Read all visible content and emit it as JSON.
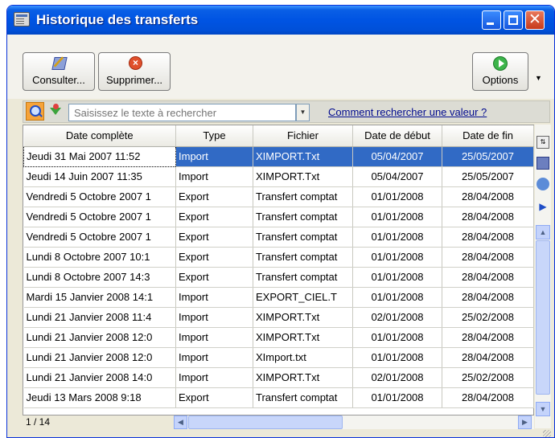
{
  "window": {
    "title": "Historique des transferts"
  },
  "toolbar": {
    "consulter_label": "Consulter...",
    "supprimer_label": "Supprimer...",
    "options_label": "Options"
  },
  "search": {
    "placeholder": "Saisissez le texte à rechercher",
    "help_link": "Comment rechercher une valeur ?"
  },
  "table": {
    "columns": [
      "Date complète",
      "Type",
      "Fichier",
      "Date de début",
      "Date de fin"
    ],
    "rows": [
      [
        "Jeudi 31 Mai 2007 11:52",
        "Import",
        "XIMPORT.Txt",
        "05/04/2007",
        "25/05/2007"
      ],
      [
        "Jeudi 14 Juin 2007 11:35",
        "Import",
        "XIMPORT.Txt",
        "05/04/2007",
        "25/05/2007"
      ],
      [
        "Vendredi 5 Octobre 2007 1",
        "Export",
        "Transfert comptat",
        "01/01/2008",
        "28/04/2008"
      ],
      [
        "Vendredi 5 Octobre 2007 1",
        "Export",
        "Transfert comptat",
        "01/01/2008",
        "28/04/2008"
      ],
      [
        "Vendredi 5 Octobre 2007 1",
        "Export",
        "Transfert comptat",
        "01/01/2008",
        "28/04/2008"
      ],
      [
        "Lundi 8 Octobre 2007 10:1",
        "Export",
        "Transfert comptat",
        "01/01/2008",
        "28/04/2008"
      ],
      [
        "Lundi 8 Octobre 2007 14:3",
        "Export",
        "Transfert comptat",
        "01/01/2008",
        "28/04/2008"
      ],
      [
        "Mardi 15 Janvier 2008 14:1",
        "Import",
        "EXPORT_CIEL.T",
        "01/01/2008",
        "28/04/2008"
      ],
      [
        "Lundi 21 Janvier 2008 11:4",
        "Import",
        "XIMPORT.Txt",
        "02/01/2008",
        "25/02/2008"
      ],
      [
        "Lundi 21 Janvier 2008 12:0",
        "Import",
        "XIMPORT.Txt",
        "01/01/2008",
        "28/04/2008"
      ],
      [
        "Lundi 21 Janvier 2008 12:0",
        "Import",
        "XImport.txt",
        "01/01/2008",
        "28/04/2008"
      ],
      [
        "Lundi 21 Janvier 2008 14:0",
        "Import",
        "XIMPORT.Txt",
        "02/01/2008",
        "25/02/2008"
      ],
      [
        "Jeudi 13 Mars 2008 9:18",
        "Export",
        "Transfert comptat",
        "01/01/2008",
        "28/04/2008"
      ]
    ]
  },
  "status": {
    "pager": "1 / 14"
  }
}
